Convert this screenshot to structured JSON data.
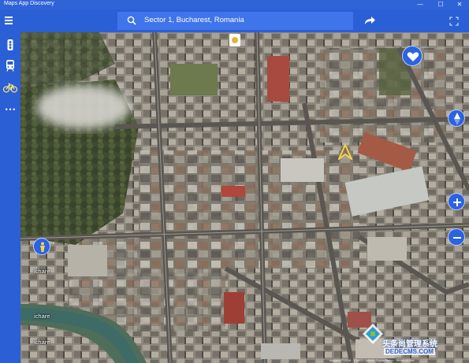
{
  "window": {
    "title": "Maps App Discovery",
    "controls": {
      "minimize": "—",
      "maximize": "☐",
      "close": "✕"
    }
  },
  "toolbar": {
    "search_value": "Sector 1, Bucharest, Romania",
    "icons": [
      "menu-icon",
      "search-icon",
      "share-icon",
      "fullscreen-icon"
    ]
  },
  "rail": {
    "items": [
      {
        "name": "traffic-icon"
      },
      {
        "name": "transit-icon"
      },
      {
        "name": "bike-icon"
      },
      {
        "name": "more-icon",
        "label": "•••"
      }
    ]
  },
  "map": {
    "street_labels": [
      "ichare",
      "ichare",
      "ichare"
    ],
    "controls": [
      "favorite-icon",
      "compass-icon",
      "zoom-in-icon",
      "zoom-out-icon",
      "person-icon"
    ],
    "watermark": {
      "line1": "头条尚管理系统",
      "line2": "DEDECMS.COM"
    },
    "credit": "Imagery ©2016 · CNES / Airbus, DigitalGlobe · Terms of Use"
  },
  "colors": {
    "accent": "#2b5fd6",
    "search_bg": "#3f74ea",
    "button": "#2b63e0"
  }
}
